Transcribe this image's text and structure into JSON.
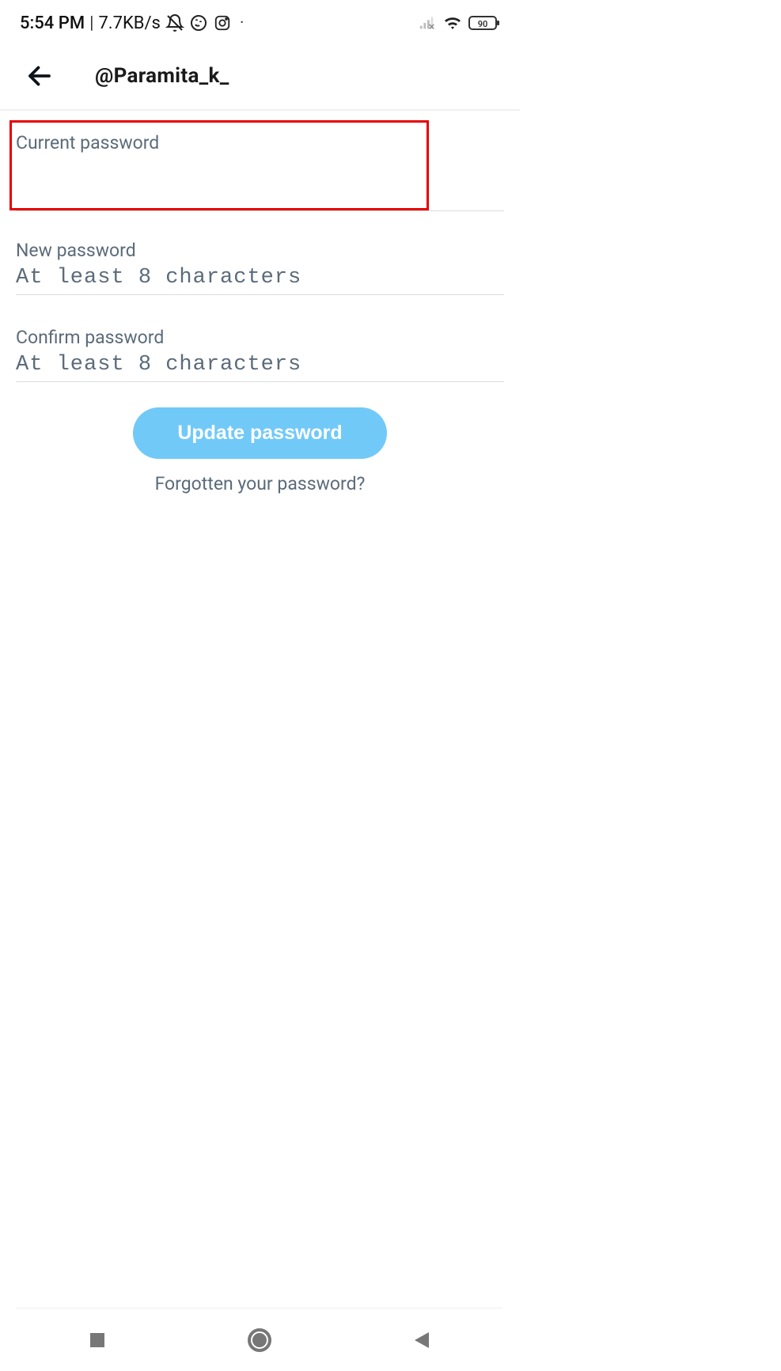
{
  "status_bar": {
    "time": "5:54 PM",
    "data_rate": "7.7KB/s",
    "battery_level": "90"
  },
  "header": {
    "title": "@Paramita_k_"
  },
  "form": {
    "current_password": {
      "label": "Current password",
      "value": ""
    },
    "new_password": {
      "label": "New password",
      "placeholder": "At least 8 characters",
      "value": ""
    },
    "confirm_password": {
      "label": "Confirm password",
      "placeholder": "At least 8 characters",
      "value": ""
    }
  },
  "actions": {
    "update_button": "Update password",
    "forgot_link": "Forgotten your password?"
  },
  "highlight": {
    "target_field": "current_password",
    "color": "#e60000"
  }
}
